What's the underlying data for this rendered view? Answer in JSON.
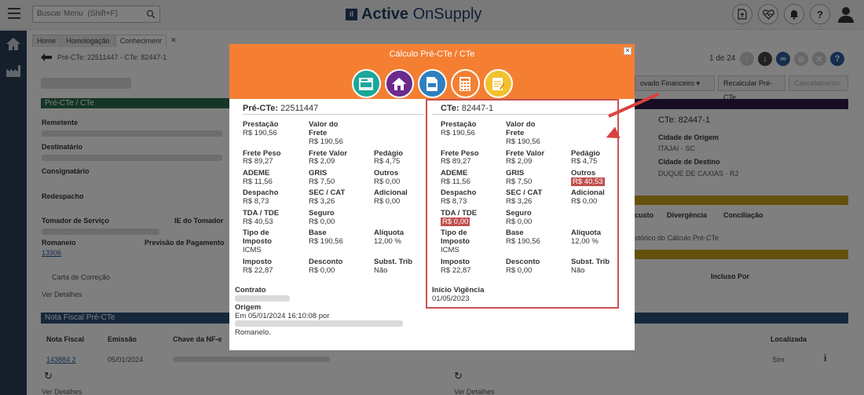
{
  "app": {
    "search_placeholder": "Buscar Menu  (Shift+F)",
    "brand_light": "OnSupply",
    "brand_bold": "Active",
    "brand_logo_text": "il"
  },
  "tabs": [
    {
      "label": "Home"
    },
    {
      "label": "Homologação"
    },
    {
      "label": "Conhecimenr"
    }
  ],
  "breadcrumb": "Pré-CTe: 22511447 - CTe: 82447-1",
  "pager": "1 de 24",
  "background": {
    "btn_aprovado": "ovado Financeiro ▾",
    "btn_recalcular": "Recalcular Pré-CTe",
    "btn_cancel": "Cancelamento",
    "section_precte": "Pré-CTe / CTe",
    "remetente": "Remetente",
    "destinatario": "Destinatário",
    "consignatario": "Consignatário",
    "redespacho": "Redespacho",
    "tomador": "Tomador de Serviço",
    "ie_tomador": "IE do Tomador",
    "romaneio": "Romaneio",
    "romaneio_val": "13906",
    "previsao": "Previsão de Pagamento",
    "carta": "Carta de Correção",
    "ver_detalhes": "Ver Detalhes",
    "nota_fiscal_title": "Nota Fiscal Pré-CTe",
    "nf_col1": "Nota Fiscal",
    "nf_col2": "Emissão",
    "nf_col3": "Chave da NF-e",
    "nf_val1": "143884 2",
    "nf_val2": "05/01/2024",
    "right_cte": "CTe: 82447-1",
    "cidade_origem": "Cidade de Origem",
    "cidade_origem_val": "ITAJAI - SC",
    "cidade_destino": "Cidade de Destino",
    "cidade_destino_val": "DUQUE DE CAXIAS - RJ",
    "custo": "custo",
    "divergencia": "Divergência",
    "conciliacao": "Conciliação",
    "historico": "stórico do Cálculo Pré-CTe",
    "incluso_por": "Incluso Por",
    "localizada": "Localizada",
    "sim": "Sim",
    "ver_detalhes2": "Ver Detalhes",
    "ver_detalhes3": "Ver Detalhes"
  },
  "modal": {
    "title": "Cálculo Pré-CTe / CTe",
    "left": {
      "head_label": "Pré-CTe:",
      "head_value": "22511447",
      "fields": [
        {
          "label": "Prestação",
          "value": "R$ 190,56"
        },
        {
          "label": "Valor do Frete",
          "value": "R$ 190,56"
        },
        {
          "label": "Frete Peso",
          "value": "R$ 89,27"
        },
        {
          "label": "Frete Valor",
          "value": "R$ 2,09"
        },
        {
          "label": "Pedágio",
          "value": "R$ 4,75"
        },
        {
          "label": "ADEME",
          "value": "R$ 11,56"
        },
        {
          "label": "GRIS",
          "value": "R$ 7,50"
        },
        {
          "label": "Outros",
          "value": "R$ 0,00"
        },
        {
          "label": "Despacho",
          "value": "R$ 8,73"
        },
        {
          "label": "SEC / CAT",
          "value": "R$ 3,26"
        },
        {
          "label": "Adicional",
          "value": "R$ 0,00"
        },
        {
          "label": "TDA / TDE",
          "value": "R$ 40,53"
        },
        {
          "label": "Seguro",
          "value": "R$ 0,00"
        },
        {
          "label": "Tipo de Imposto",
          "value": "ICMS"
        },
        {
          "label": "Base",
          "value": "R$ 190,56"
        },
        {
          "label": "Alíquota",
          "value": "12,00 %"
        },
        {
          "label": "Imposto",
          "value": "R$ 22,87"
        },
        {
          "label": "Desconto",
          "value": "R$ 0,00"
        },
        {
          "label": "Subst. Trib",
          "value": "Não"
        }
      ],
      "contrato_label": "Contrato",
      "origem_label": "Origem",
      "origem_text1": "Em 05/01/2024 16:10:08 por",
      "origem_text2": "Romanelo."
    },
    "right": {
      "head_label": "CTe:",
      "head_value": "82447-1",
      "fields": [
        {
          "label": "Prestação",
          "value": "R$ 190,56"
        },
        {
          "label": "Valor do Frete",
          "value": "R$ 190,56"
        },
        {
          "label": "Frete Peso",
          "value": "R$ 89,27"
        },
        {
          "label": "Frete Valor",
          "value": "R$ 2,09"
        },
        {
          "label": "Pedágio",
          "value": "R$ 4,75"
        },
        {
          "label": "ADEME",
          "value": "R$ 11,56"
        },
        {
          "label": "GRIS",
          "value": "R$ 7,50"
        },
        {
          "label": "Outros",
          "value": "R$ 40,53"
        },
        {
          "label": "Despacho",
          "value": "R$ 8,73"
        },
        {
          "label": "SEC / CAT",
          "value": "R$ 3,26"
        },
        {
          "label": "Adicional",
          "value": "R$ 0,00"
        },
        {
          "label": "TDA / TDE",
          "value": "R$ 0,00"
        },
        {
          "label": "Seguro",
          "value": "R$ 0,00"
        },
        {
          "label": "Tipo de Imposto",
          "value": "ICMS"
        },
        {
          "label": "Base",
          "value": "R$ 190,56"
        },
        {
          "label": "Alíquota",
          "value": "12,00 %"
        },
        {
          "label": "Imposto",
          "value": "R$ 22,87"
        },
        {
          "label": "Desconto",
          "value": "R$ 0,00"
        },
        {
          "label": "Subst. Trib",
          "value": "Não"
        }
      ],
      "vigencia_label": "Início Vigência",
      "vigencia_value": "01/05/2023"
    },
    "colors": {
      "header": "#f47f33",
      "highlight": "#c0504d",
      "box": "#c9524f"
    },
    "circle_icons": [
      {
        "name": "cte-doc-icon",
        "color": "#1aa79a"
      },
      {
        "name": "house-icon",
        "color": "#6b2a8c"
      },
      {
        "name": "xml-doc-icon",
        "color": "#2f7fc1"
      },
      {
        "name": "calculator-icon",
        "color": "#f47f33"
      },
      {
        "name": "notes-icon",
        "color": "#f2c12e"
      }
    ]
  }
}
